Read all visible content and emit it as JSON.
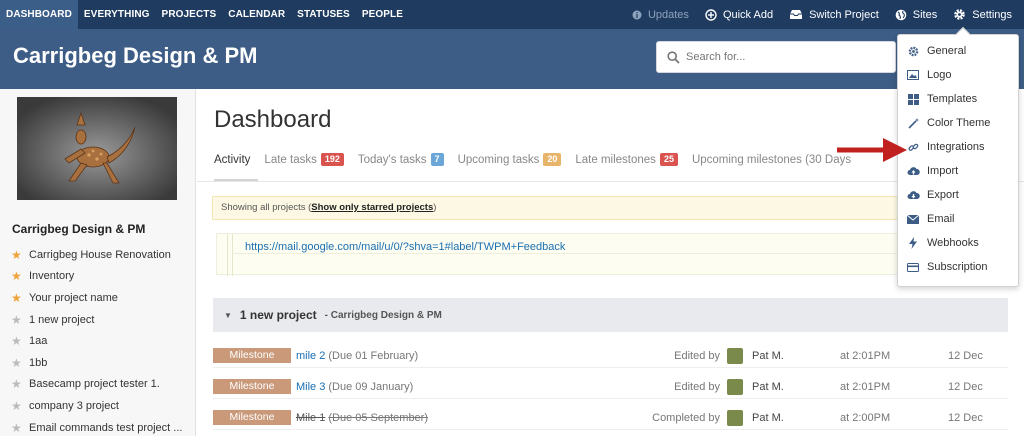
{
  "topnav": {
    "tabs": [
      "DASHBOARD",
      "EVERYTHING",
      "PROJECTS",
      "CALENDAR",
      "STATUSES",
      "PEOPLE"
    ],
    "updates_label": "Updates",
    "quick_add_label": "Quick Add",
    "switch_project_label": "Switch Project",
    "sites_label": "Sites",
    "settings_label": "Settings"
  },
  "header": {
    "title": "Carrigbeg Design & PM",
    "search_placeholder": "Search for..."
  },
  "sidebar": {
    "title": "Carrigbeg Design & PM",
    "projects": [
      {
        "name": "Carrigbeg House Renovation",
        "starred": true
      },
      {
        "name": "Inventory",
        "starred": true
      },
      {
        "name": "Your project name",
        "starred": true
      },
      {
        "name": "1 new project",
        "starred": false
      },
      {
        "name": "1aa",
        "starred": false
      },
      {
        "name": "1bb",
        "starred": false
      },
      {
        "name": "Basecamp project tester 1.",
        "starred": false
      },
      {
        "name": "company 3 project",
        "starred": false
      },
      {
        "name": "Email commands test project ...",
        "starred": false
      }
    ]
  },
  "main": {
    "page_title": "Dashboard",
    "tabs": [
      {
        "label": "Activity",
        "badge": ""
      },
      {
        "label": "Late tasks",
        "badge": "192",
        "badge_color": "#d9534f"
      },
      {
        "label": "Today's tasks",
        "badge": "7",
        "badge_color": "#6aa7d8"
      },
      {
        "label": "Upcoming tasks",
        "badge": "20",
        "badge_color": "#e8b46a"
      },
      {
        "label": "Late milestones",
        "badge": "25",
        "badge_color": "#d9534f"
      },
      {
        "label": "Upcoming milestones (30 Days",
        "badge": ""
      }
    ],
    "notice": {
      "text": "Showing all projects (",
      "link": "Show only starred projects",
      "end": ")"
    },
    "url_text": "https://mail.google.com/mail/u/0/?shva=1#label/TWPM+Feedback",
    "project_group": {
      "name": "1 new project",
      "sub": "- Carrigbeg Design & PM"
    },
    "rows": [
      {
        "type": "Milestone",
        "title": "mile 2",
        "due": "(Due 01 February)",
        "action": "Edited by",
        "user": "Pat M.",
        "time": "at 2:01PM",
        "date": "12 Dec",
        "done": false
      },
      {
        "type": "Milestone",
        "title": "Mile 3",
        "due": "(Due 09 January)",
        "action": "Edited by",
        "user": "Pat M.",
        "time": "at 2:01PM",
        "date": "12 Dec",
        "done": false
      },
      {
        "type": "Milestone",
        "title": "Mile 1",
        "due": "(Due 05 September)",
        "action": "Completed by",
        "user": "Pat M.",
        "time": "at 2:00PM",
        "date": "12 Dec",
        "done": true
      }
    ]
  },
  "settings_menu": {
    "items": [
      "General",
      "Logo",
      "Templates",
      "Color Theme",
      "Integrations",
      "Import",
      "Export",
      "Email",
      "Webhooks",
      "Subscription"
    ],
    "icons": [
      "gear-icon",
      "image-icon",
      "grid-icon",
      "wand-icon",
      "link-icon",
      "cloud-upload-icon",
      "cloud-download-icon",
      "envelope-icon",
      "bolt-icon",
      "card-icon"
    ]
  },
  "colors": {
    "topnav_bg": "#1f3b60",
    "header_bg": "#3d5d86",
    "milestone_tag": "#c9997a",
    "star_active": "#f0a23b",
    "star_inactive": "#bbbbbb",
    "arrow": "#c0201e"
  }
}
